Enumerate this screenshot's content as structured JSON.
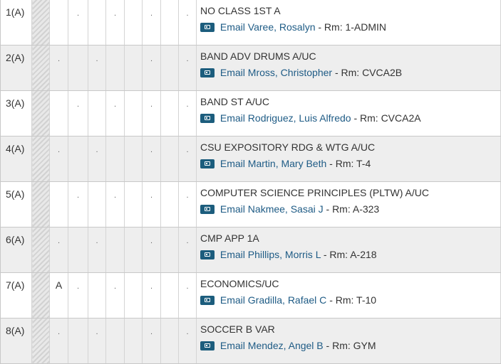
{
  "rows": [
    {
      "period": "1(A)",
      "marks": [
        "",
        "",
        ".",
        "",
        ".",
        "",
        ".",
        "",
        "."
      ],
      "course": "NO CLASS 1ST A",
      "email_label": "Email",
      "teacher": "Varee, Rosalyn",
      "separator": "- Rm:",
      "room": "1-ADMIN"
    },
    {
      "period": "2(A)",
      "marks": [
        "",
        ".",
        "",
        ".",
        "",
        "",
        ".",
        "",
        "."
      ],
      "course": "BAND ADV DRUMS A/UC",
      "email_label": "Email",
      "teacher": "Mross, Christopher",
      "separator": "- Rm:",
      "room": "CVCA2B"
    },
    {
      "period": "3(A)",
      "marks": [
        "",
        "",
        ".",
        "",
        ".",
        "",
        ".",
        "",
        "."
      ],
      "course": "BAND ST A/UC",
      "email_label": "Email",
      "teacher": "Rodriguez, Luis Alfredo",
      "separator": "- Rm:",
      "room": "CVCA2A"
    },
    {
      "period": "4(A)",
      "marks": [
        "",
        ".",
        "",
        ".",
        "",
        "",
        ".",
        "",
        "."
      ],
      "course": "CSU EXPOSITORY RDG & WTG A/UC",
      "email_label": "Email",
      "teacher": "Martin, Mary Beth",
      "separator": "- Rm:",
      "room": "T-4"
    },
    {
      "period": "5(A)",
      "marks": [
        "",
        "",
        ".",
        "",
        ".",
        "",
        ".",
        "",
        "."
      ],
      "course": "COMPUTER SCIENCE PRINCIPLES (PLTW) A/UC",
      "email_label": "Email",
      "teacher": "Nakmee, Sasai J",
      "separator": "- Rm:",
      "room": "A-323"
    },
    {
      "period": "6(A)",
      "marks": [
        "",
        ".",
        "",
        ".",
        "",
        "",
        ".",
        "",
        "."
      ],
      "course": "CMP APP 1A",
      "email_label": "Email",
      "teacher": "Phillips, Morris L",
      "separator": "- Rm:",
      "room": "A-218"
    },
    {
      "period": "7(A)",
      "marks": [
        "",
        "A",
        ".",
        "",
        ".",
        "",
        ".",
        "",
        "."
      ],
      "course": "ECONOMICS/UC",
      "email_label": "Email",
      "teacher": "Gradilla, Rafael C",
      "separator": "- Rm:",
      "room": "T-10"
    },
    {
      "period": "8(A)",
      "marks": [
        "",
        ".",
        "",
        ".",
        "",
        "",
        ".",
        "",
        "."
      ],
      "course": "SOCCER B VAR",
      "email_label": "Email",
      "teacher": "Mendez, Angel B",
      "separator": "- Rm:",
      "room": "GYM"
    }
  ],
  "icon": {
    "name": "email-card-icon",
    "color": "#1c5d7d"
  },
  "colors": {
    "link": "#1e5b85",
    "alt_row": "#eeeeee"
  }
}
